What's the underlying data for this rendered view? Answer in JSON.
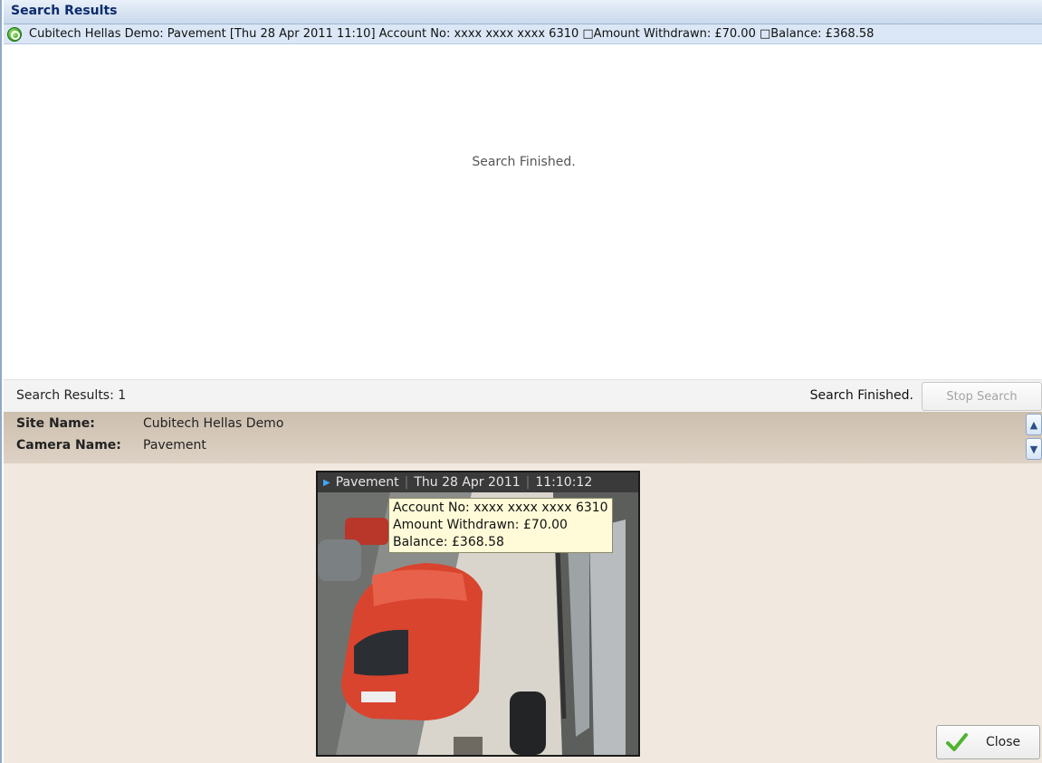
{
  "window": {
    "title": "Search Results"
  },
  "result": {
    "text": "Cubitech Hellas Demo: Pavement [Thu 28 Apr 2011  11:10] Account No: xxxx xxxx xxxx 6310 □Amount Withdrawn: £70.00 □Balance: £368.58",
    "icon": "search-result-icon"
  },
  "results_area": {
    "message": "Search Finished."
  },
  "status": {
    "count_label": "Search Results: 1",
    "state": "Search Finished.",
    "stop_button": "Stop Search"
  },
  "details": {
    "site_label": "Site Name:",
    "site_value": "Cubitech Hellas Demo",
    "camera_label": "Camera Name:",
    "camera_value": "Pavement"
  },
  "camera": {
    "name": "Pavement",
    "date": "Thu 28 Apr 2011",
    "time": "11:10:12",
    "overlay": {
      "line1": "Account No: xxxx xxxx xxxx 6310",
      "line2": "Amount Withdrawn: £70.00",
      "line3": "Balance: £368.58"
    }
  },
  "close_button": "Close",
  "colors": {
    "title": "#0b2b6a",
    "detail_panel": "#cdbfae",
    "preview_bg": "#f1e9df",
    "car": "#e0402a"
  }
}
